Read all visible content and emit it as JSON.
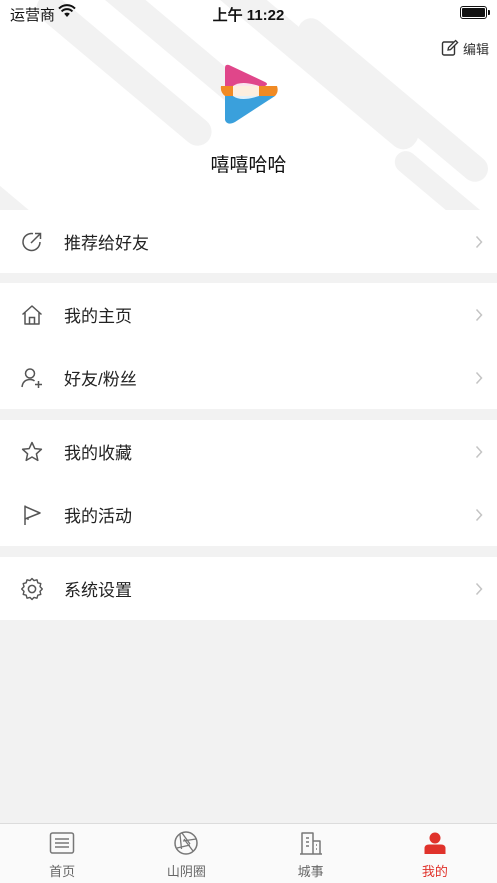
{
  "status_bar": {
    "carrier": "运营商",
    "time": "上午 11:22"
  },
  "header": {
    "edit_label": "编辑",
    "username": "嘻嘻哈哈"
  },
  "menu": {
    "recommend": "推荐给好友",
    "homepage": "我的主页",
    "friends": "好友/粉丝",
    "favorites": "我的收藏",
    "activities": "我的活动",
    "settings": "系统设置"
  },
  "tabbar": {
    "items": [
      {
        "label": "首页",
        "icon": "news-icon"
      },
      {
        "label": "山阴圈",
        "icon": "aperture-icon"
      },
      {
        "label": "城事",
        "icon": "building-icon"
      },
      {
        "label": "我的",
        "icon": "user-icon"
      }
    ],
    "active_index": 3,
    "active_color": "#e0322b"
  }
}
